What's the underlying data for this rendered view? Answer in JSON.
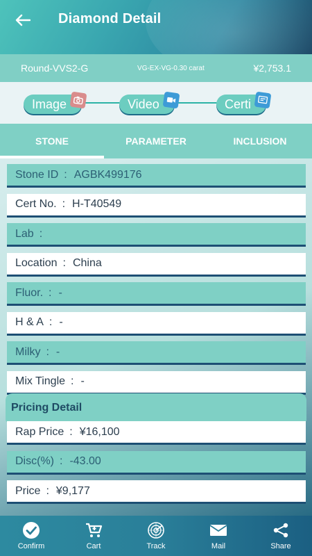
{
  "header": {
    "title": "Diamond Detail"
  },
  "summary": {
    "grade": "Round-VVS2-G",
    "spec": "VG-EX-VG-0.30 carat",
    "price": "¥2,753.1"
  },
  "media": {
    "image": "Image",
    "video": "Video",
    "certi": "Certi"
  },
  "tabs": [
    {
      "label": "STONE",
      "active": true
    },
    {
      "label": "PARAMETER",
      "active": false
    },
    {
      "label": "INCLUSION",
      "active": false
    }
  ],
  "details": [
    {
      "label": "Stone ID",
      "sep": ":",
      "value": "AGBK499176"
    },
    {
      "label": "Cert No.",
      "sep": ":",
      "value": "H-T40549"
    },
    {
      "label": "Lab",
      "sep": ":",
      "value": ""
    },
    {
      "label": "Location",
      "sep": ":",
      "value": "China"
    },
    {
      "label": "Fluor.",
      "sep": ":",
      "value": "-"
    },
    {
      "label": "H & A",
      "sep": ":",
      "value": "-"
    },
    {
      "label": "Milky",
      "sep": ":",
      "value": "-"
    },
    {
      "label": "Mix Tingle",
      "sep": ":",
      "value": "-"
    }
  ],
  "pricing": {
    "title": "Pricing Detail",
    "rows": [
      {
        "label": "Rap Price",
        "sep": ":",
        "value": "¥16,100"
      },
      {
        "label": "Disc(%)",
        "sep": ":",
        "value": "-43.00"
      },
      {
        "label": "Price",
        "sep": ":",
        "value": "¥9,177"
      }
    ]
  },
  "nav": [
    {
      "label": "Confirm",
      "icon": "check-circle-icon"
    },
    {
      "label": "Cart",
      "icon": "cart-icon"
    },
    {
      "label": "Track",
      "icon": "radar-icon"
    },
    {
      "label": "Mail",
      "icon": "mail-icon"
    },
    {
      "label": "Share",
      "icon": "share-icon"
    }
  ],
  "colors": {
    "teal": "#7fd0c5",
    "navy": "#1d4f74",
    "header_dark": "#0f3e5e"
  }
}
